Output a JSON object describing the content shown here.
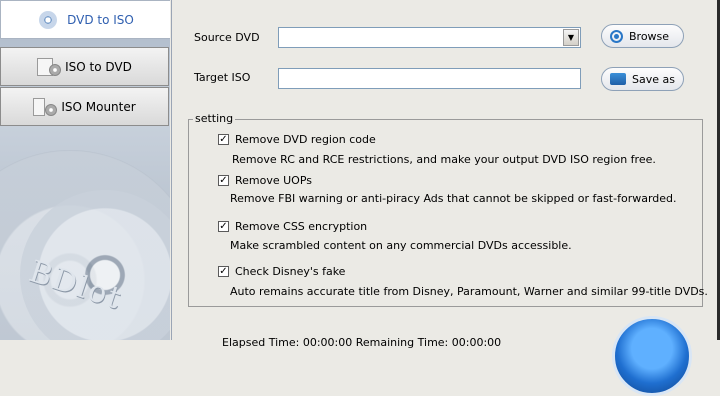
{
  "sidebar": {
    "tabs": [
      {
        "label": "DVD to ISO",
        "icon": "cd-icon"
      },
      {
        "label": "ISO to DVD",
        "icon": "document-cd-icon"
      },
      {
        "label": "ISO Mounter",
        "icon": "mounter-icon"
      }
    ],
    "logo_text": "BDlot"
  },
  "source": {
    "label": "Source DVD",
    "value": ""
  },
  "target": {
    "label": "Target ISO",
    "value": ""
  },
  "buttons": {
    "browse": "Browse",
    "save_as": "Save as"
  },
  "setting": {
    "legend": "setting",
    "options": [
      {
        "label": "Remove DVD region code",
        "checked": true,
        "description": "Remove RC and RCE restrictions, and make your output DVD ISO region free."
      },
      {
        "label": "Remove UOPs",
        "checked": true,
        "description": "Remove FBI warning or anti-piracy Ads that cannot be skipped or fast-forwarded."
      },
      {
        "label": "Remove CSS encryption",
        "checked": true,
        "description": "Make scrambled content on any commercial DVDs accessible."
      },
      {
        "label": "Check Disney's fake",
        "checked": true,
        "description": "Auto remains accurate title from Disney, Paramount, Warner and similar 99-title DVDs."
      }
    ]
  },
  "status": {
    "text": "Elapsed Time: 00:00:00    Remaining Time: 00:00:00"
  },
  "colors": {
    "accent": "#2f5fb0",
    "start": "#1f6fd0"
  }
}
